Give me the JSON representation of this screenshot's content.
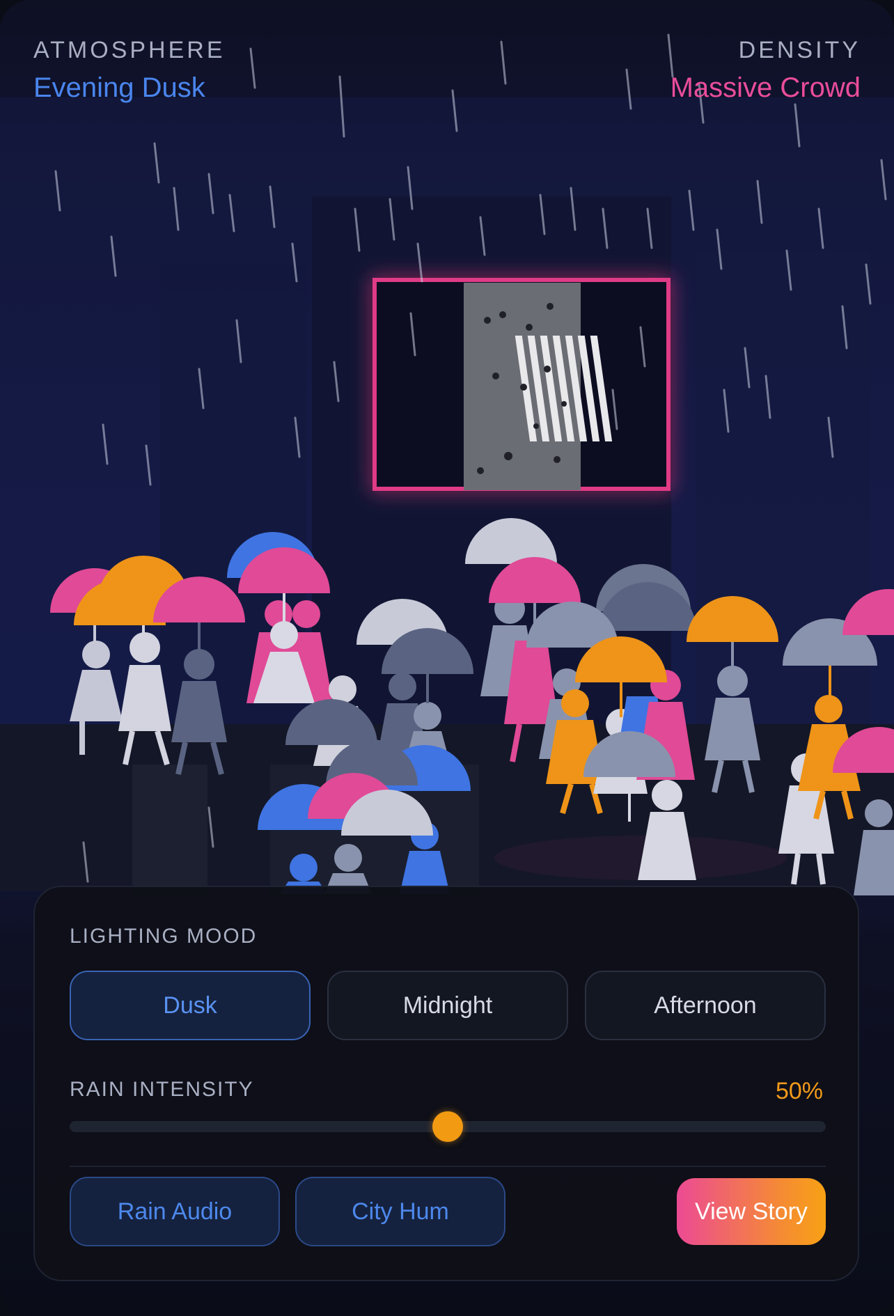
{
  "header": {
    "atmosphere_label": "ATMOSPHERE",
    "atmosphere_value": "Evening Dusk",
    "density_label": "DENSITY",
    "density_value": "Massive Crowd"
  },
  "lighting": {
    "label": "LIGHTING MOOD",
    "options": [
      "Dusk",
      "Midnight",
      "Afternoon"
    ],
    "selected": "Dusk"
  },
  "rain": {
    "label": "RAIN INTENSITY",
    "value_text": "50%",
    "value": 0.5
  },
  "actions": {
    "rain_audio": "Rain Audio",
    "city_hum": "City Hum",
    "view_story": "View Story"
  },
  "colors": {
    "accent_blue": "#4a85ee",
    "accent_pink": "#ea4d9a",
    "accent_orange": "#f29a12",
    "background": "#141a44"
  },
  "scene": {
    "description_icons": [
      "umbrella-icon",
      "pedestrian-icon",
      "billboard-screen",
      "rain-streak"
    ],
    "billboard_frame_color": "#e03b86"
  }
}
